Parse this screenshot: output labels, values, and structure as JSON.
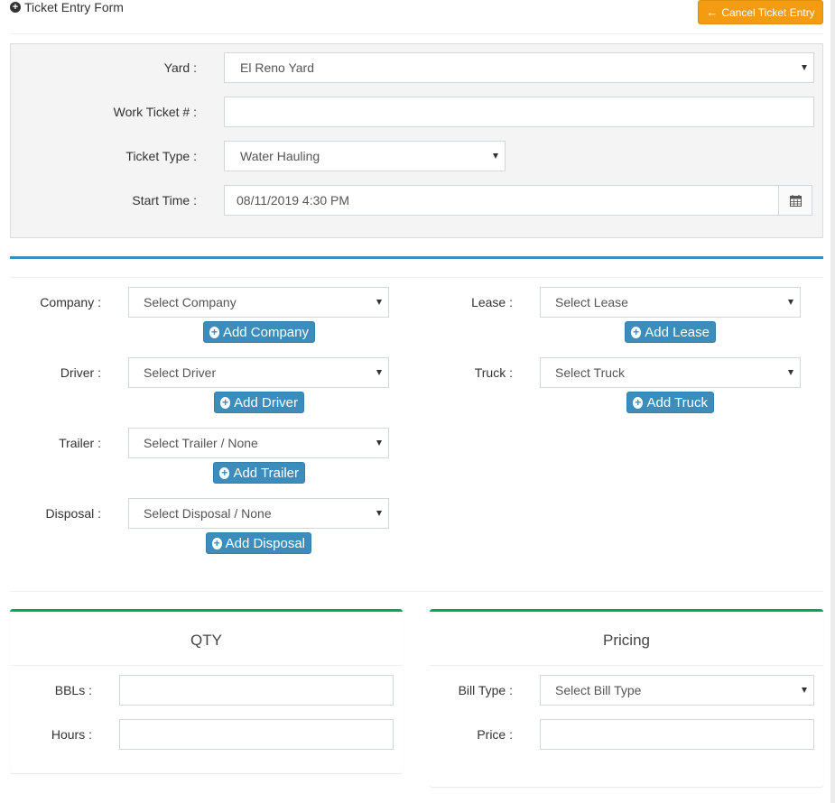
{
  "header": {
    "title": "Ticket Entry Form",
    "cancel_label": "Cancel Ticket Entry"
  },
  "ticket": {
    "yard_label": "Yard :",
    "yard_value": "El Reno Yard",
    "work_ticket_label": "Work Ticket # :",
    "work_ticket_value": "",
    "ticket_type_label": "Ticket Type :",
    "ticket_type_value": "Water Hauling",
    "start_time_label": "Start Time :",
    "start_time_value": "08/11/2019 4:30 PM"
  },
  "assign": {
    "company_label": "Company :",
    "company_value": "Select Company",
    "add_company": "Add Company",
    "lease_label": "Lease :",
    "lease_value": "Select Lease",
    "add_lease": "Add Lease",
    "driver_label": "Driver :",
    "driver_value": "Select Driver",
    "add_driver": "Add Driver",
    "truck_label": "Truck :",
    "truck_value": "Select Truck",
    "add_truck": "Add Truck",
    "trailer_label": "Trailer :",
    "trailer_value": "Select Trailer / None",
    "add_trailer": "Add Trailer",
    "disposal_label": "Disposal :",
    "disposal_value": "Select Disposal / None",
    "add_disposal": "Add Disposal"
  },
  "qty": {
    "title": "QTY",
    "bbls_label": "BBLs :",
    "hours_label": "Hours :"
  },
  "pricing": {
    "title": "Pricing",
    "bill_type_label": "Bill Type :",
    "bill_type_value": "Select Bill Type",
    "price_label": "Price :"
  },
  "colors": {
    "primary": "#3c8dbc",
    "warning": "#f39c12",
    "success": "#00a65a"
  },
  "icons": [
    "plus-circle-icon",
    "arrow-left-icon",
    "calendar-icon",
    "caret-down-icon"
  ]
}
